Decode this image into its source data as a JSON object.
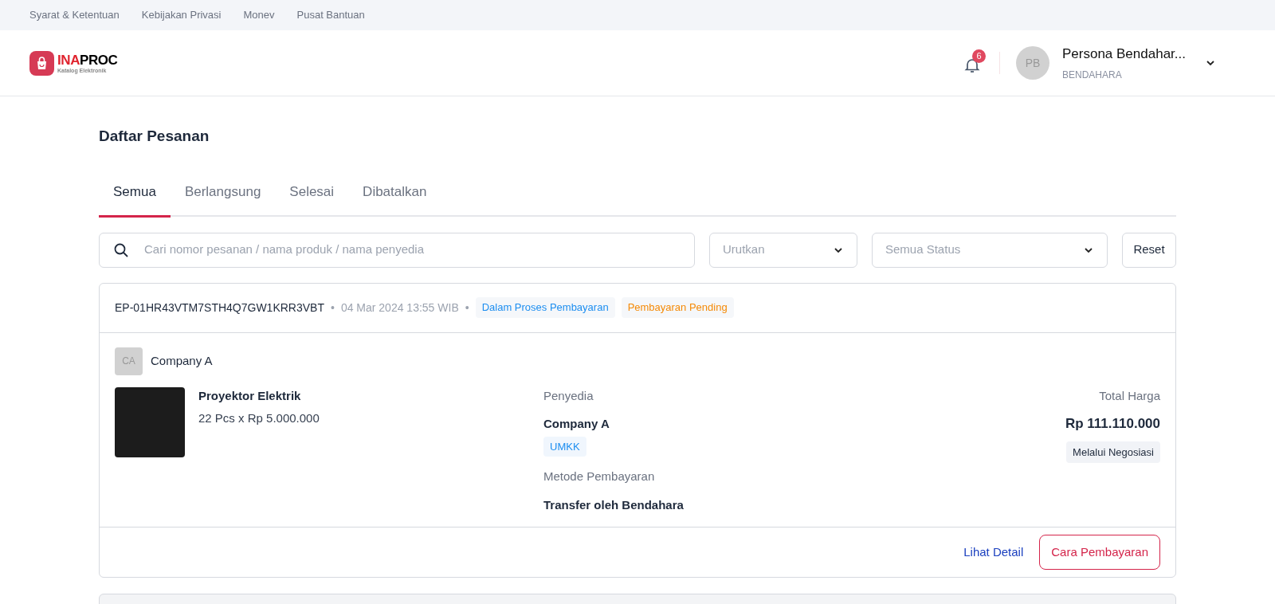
{
  "top_links": [
    "Syarat & Ketentuan",
    "Kebijakan Privasi",
    "Monev",
    "Pusat Bantuan"
  ],
  "logo": {
    "brand_accent": "INA",
    "brand_rest": "PROC",
    "subtitle": "Katalog Elektronik"
  },
  "header": {
    "notification_count": "6",
    "user": {
      "initials": "PB",
      "name": "Persona Bendahar...",
      "role": "BENDAHARA"
    }
  },
  "page_title": "Daftar Pesanan",
  "tabs": [
    {
      "label": "Semua",
      "selected": true
    },
    {
      "label": "Berlangsung",
      "selected": false
    },
    {
      "label": "Selesai",
      "selected": false
    },
    {
      "label": "Dibatalkan",
      "selected": false
    }
  ],
  "search": {
    "placeholder": "Cari nomor pesanan / nama produk / nama penyedia"
  },
  "filters": [
    {
      "placeholder": "Urutkan"
    },
    {
      "placeholder": "Semua Status"
    }
  ],
  "reset_button": "Reset",
  "orders": [
    {
      "order_number": "EP-01HR43VTM7STH4Q7GW1KRR3VBT",
      "separator": "•",
      "date": "04 Mar 2024 13:55 WIB",
      "separator_2": "•",
      "statuses": [
        {
          "label": "Dalam Proses Pembayaran",
          "color": "#1d8ef0"
        },
        {
          "label": "Pembayaran Pending",
          "color": "#f58a07"
        }
      ],
      "buyer": {
        "initials": "CA",
        "name": "Company A"
      },
      "product": {
        "name": "Proyektor Elektrik",
        "quantity_price": "22 Pcs x Rp 5.000.000"
      },
      "supplier_label": "Penyedia",
      "supplier": "Company A",
      "supplier_tag": "UMKK",
      "payment_method_label": "Metode Pembayaran",
      "payment_method": "Transfer oleh Bendahara",
      "total_label": "Total Harga",
      "total": "Rp 111.110.000",
      "price_tag": "Melalui Negosiasi",
      "detail_link": "Lihat Detail",
      "payment_button": "Cara Pembayaran"
    }
  ]
}
